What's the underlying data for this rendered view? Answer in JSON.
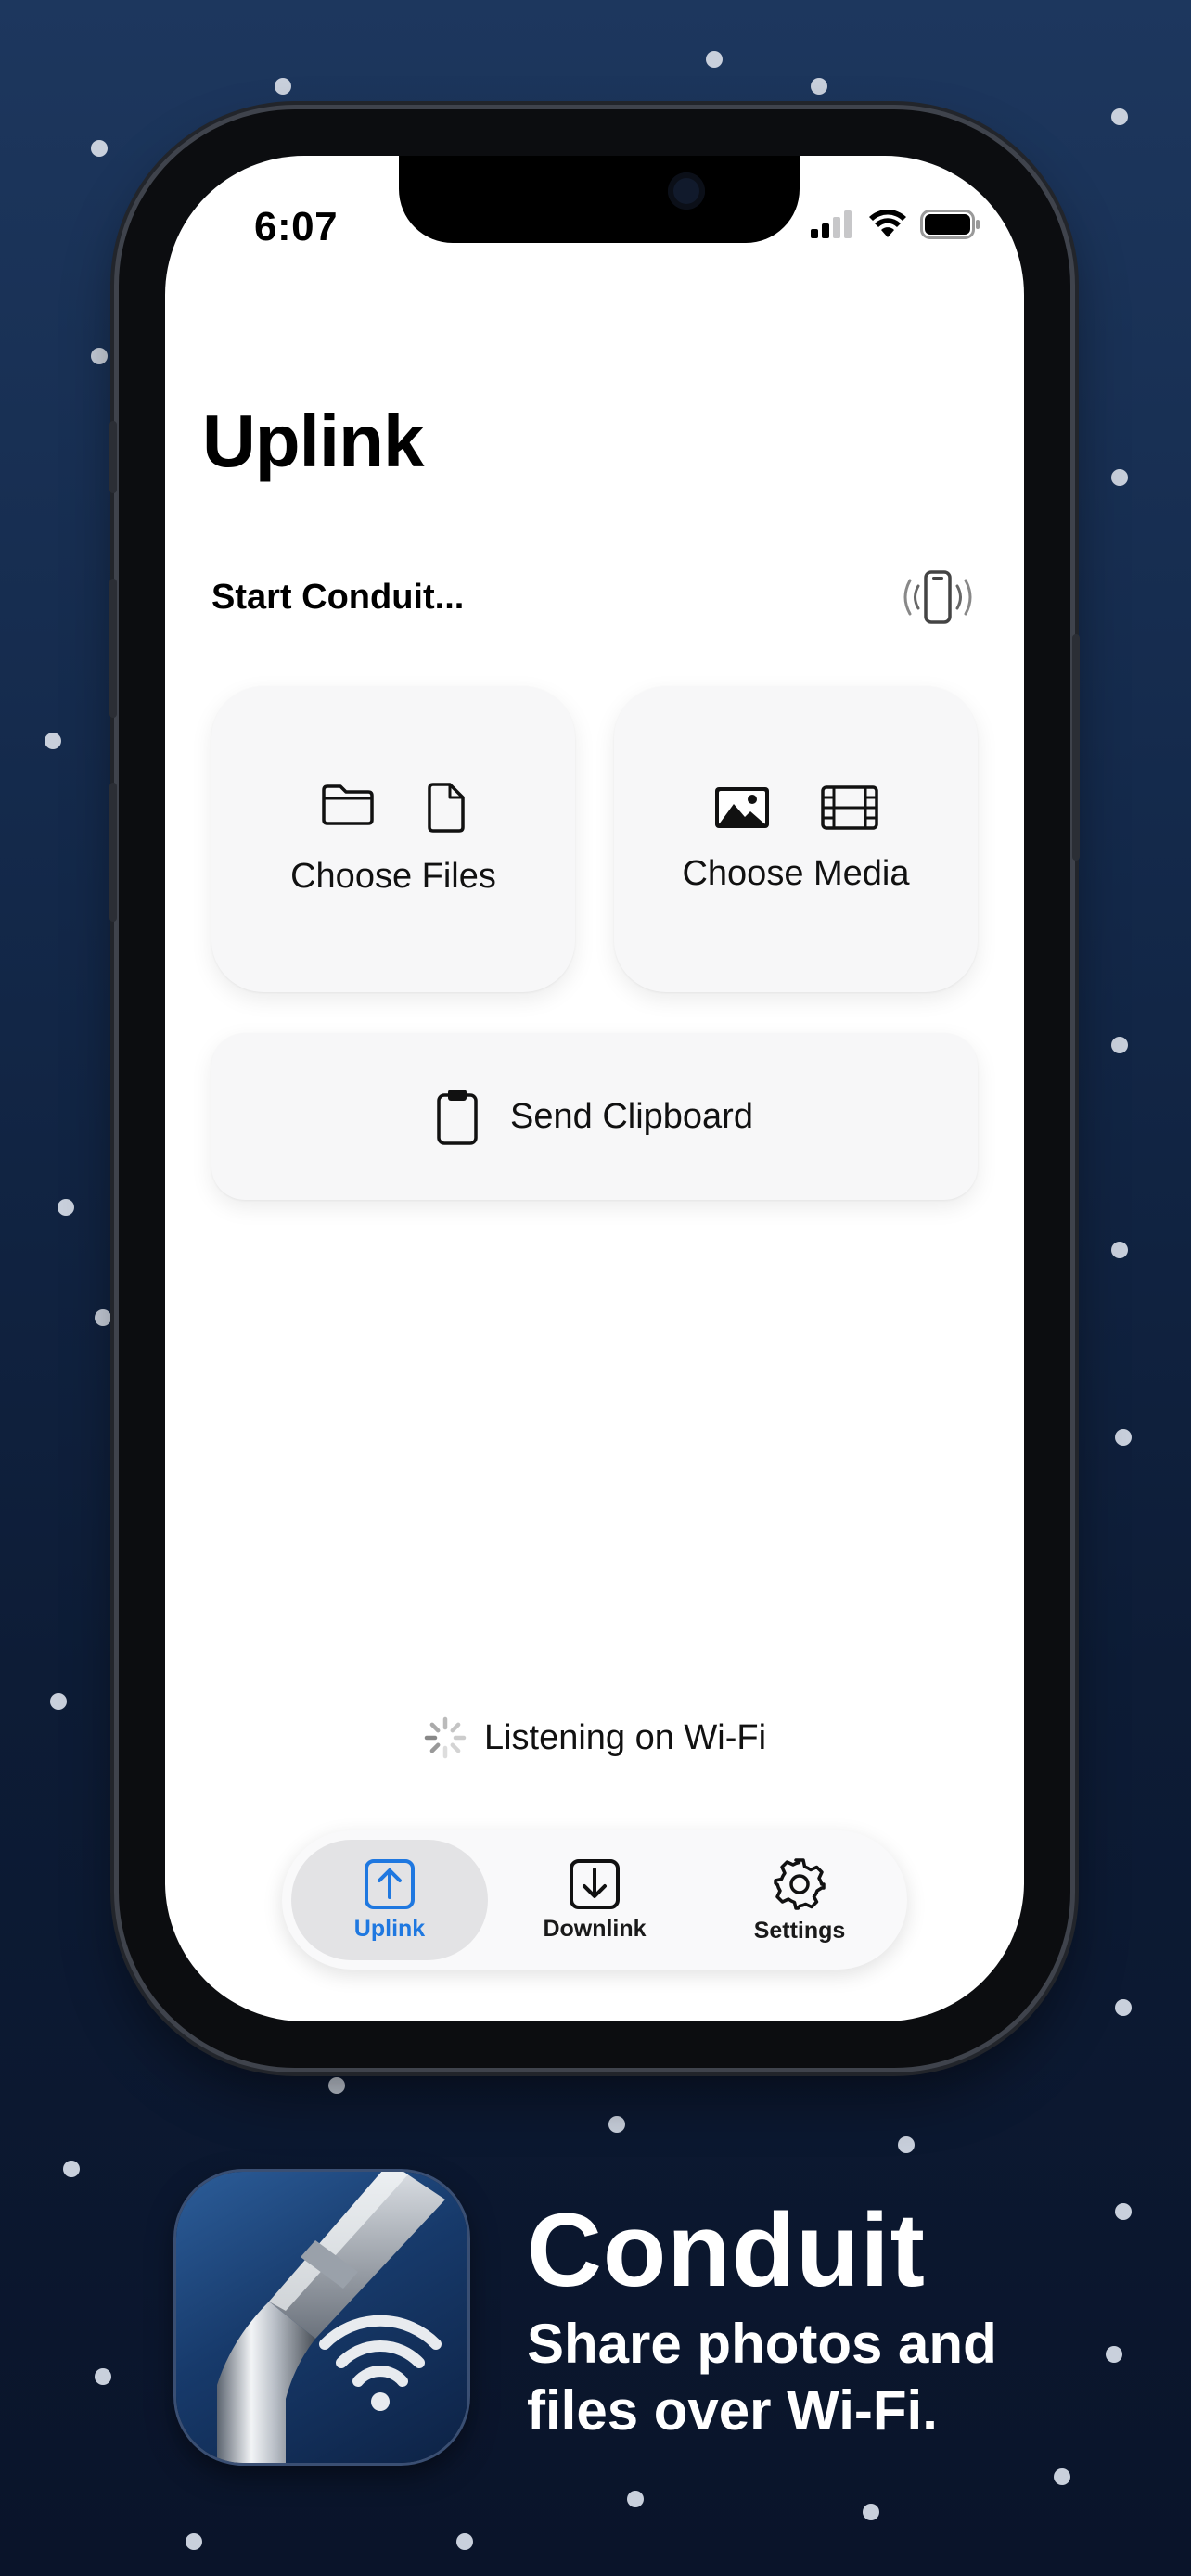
{
  "status": {
    "time": "6:07"
  },
  "screen": {
    "title": "Uplink"
  },
  "start": {
    "label": "Start Conduit..."
  },
  "actions": {
    "choose_files": "Choose Files",
    "choose_media": "Choose Media",
    "send_clipboard": "Send Clipboard"
  },
  "status_line": {
    "text": "Listening on Wi-Fi"
  },
  "tabs": [
    {
      "label": "Uplink",
      "active": true
    },
    {
      "label": "Downlink",
      "active": false
    },
    {
      "label": "Settings",
      "active": false
    }
  ],
  "promo": {
    "app_name": "Conduit",
    "tagline_line1": "Share photos and",
    "tagline_line2": "files over Wi-Fi."
  },
  "colors": {
    "accent": "#1f78e0",
    "background_top": "#1d375e",
    "background_bottom": "#0a142a"
  }
}
